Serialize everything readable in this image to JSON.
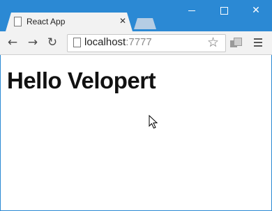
{
  "browser": {
    "tab": {
      "title": "React App"
    },
    "address_bar": {
      "host": "localhost",
      "port": ":7777"
    }
  },
  "page": {
    "heading": "Hello Velopert"
  },
  "icons": {
    "tab_favicon": "page-icon",
    "tab_close": "close-icon",
    "back": "arrow-left-icon",
    "forward": "arrow-right-icon",
    "reload": "reload-icon",
    "page": "page-icon",
    "bookmark": "star-icon",
    "extension": "extension-icon",
    "menu": "hamburger-menu-icon",
    "cursor": "mouse-pointer-icon"
  },
  "colors": {
    "title_bar": "#2b89d4",
    "tab_bg": "#f2f2f2",
    "content_bg": "#ffffff"
  }
}
